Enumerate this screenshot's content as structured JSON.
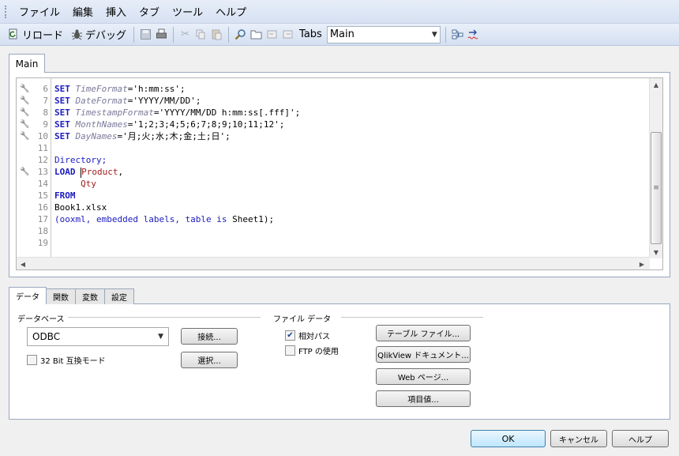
{
  "menu": [
    "ファイル",
    "編集",
    "挿入",
    "タブ",
    "ツール",
    "ヘルプ"
  ],
  "toolbar": {
    "reload_label": "リロード",
    "debug_label": "デバッグ",
    "tabs_label": "Tabs",
    "tabs_value": "Main"
  },
  "editor": {
    "tab_label": "Main",
    "lines": [
      {
        "n": "6",
        "tokens": [
          [
            "kw",
            "SET "
          ],
          [
            "var",
            "TimeFormat"
          ],
          [
            "str",
            "='h:mm:ss';"
          ]
        ]
      },
      {
        "n": "7",
        "tokens": [
          [
            "kw",
            "SET "
          ],
          [
            "var",
            "DateFormat"
          ],
          [
            "str",
            "='YYYY/MM/DD';"
          ]
        ]
      },
      {
        "n": "8",
        "tokens": [
          [
            "kw",
            "SET "
          ],
          [
            "var",
            "TimestampFormat"
          ],
          [
            "str",
            "='YYYY/MM/DD h:mm:ss[.fff]';"
          ]
        ]
      },
      {
        "n": "9",
        "tokens": [
          [
            "kw",
            "SET "
          ],
          [
            "var",
            "MonthNames"
          ],
          [
            "str",
            "='1;2;3;4;5;6;7;8;9;10;11;12';"
          ]
        ]
      },
      {
        "n": "10",
        "tokens": [
          [
            "kw",
            "SET "
          ],
          [
            "var",
            "DayNames"
          ],
          [
            "str",
            "='月;火;水;木;金;土;日';"
          ]
        ]
      },
      {
        "n": "11",
        "tokens": []
      },
      {
        "n": "12",
        "tokens": [
          [
            "kw2",
            "Directory;"
          ]
        ]
      },
      {
        "n": "13",
        "tokens": [
          [
            "kw",
            "LOAD "
          ],
          [
            "cursor",
            ""
          ],
          [
            "field",
            "Product"
          ],
          [
            "plain",
            ","
          ]
        ]
      },
      {
        "n": "14",
        "tokens": [
          [
            "plain",
            "     "
          ],
          [
            "field",
            "Qty"
          ]
        ]
      },
      {
        "n": "15",
        "tokens": [
          [
            "kw",
            "FROM"
          ]
        ]
      },
      {
        "n": "16",
        "tokens": [
          [
            "plain",
            "Book1.xlsx"
          ]
        ]
      },
      {
        "n": "17",
        "tokens": [
          [
            "kw2",
            "(ooxml, embedded labels, table is "
          ],
          [
            "plain",
            "Sheet1);"
          ]
        ]
      },
      {
        "n": "18",
        "tokens": []
      },
      {
        "n": "19",
        "tokens": []
      }
    ],
    "wrench_lines": [
      "6",
      "7",
      "8",
      "9",
      "10",
      "13"
    ]
  },
  "bottom_tabs": [
    "データ",
    "関数",
    "変数",
    "設定"
  ],
  "data_tab": {
    "database_label": "データベース",
    "database_value": "ODBC",
    "compat_label": "32 Bit 互換モード",
    "connect_button": "接続...",
    "select_button": "選択...",
    "file_data_label": "ファイル データ",
    "relative_path_label": "相対パス",
    "relative_path_checked": true,
    "ftp_label": "FTP の使用",
    "ftp_checked": false,
    "table_file_button": "テーブル ファイル...",
    "qlikview_doc_button": "QlikView ドキュメント...",
    "web_page_button": "Web ページ...",
    "field_value_button": "項目値..."
  },
  "dialog": {
    "ok": "OK",
    "cancel": "キャンセル",
    "help": "ヘルプ"
  }
}
